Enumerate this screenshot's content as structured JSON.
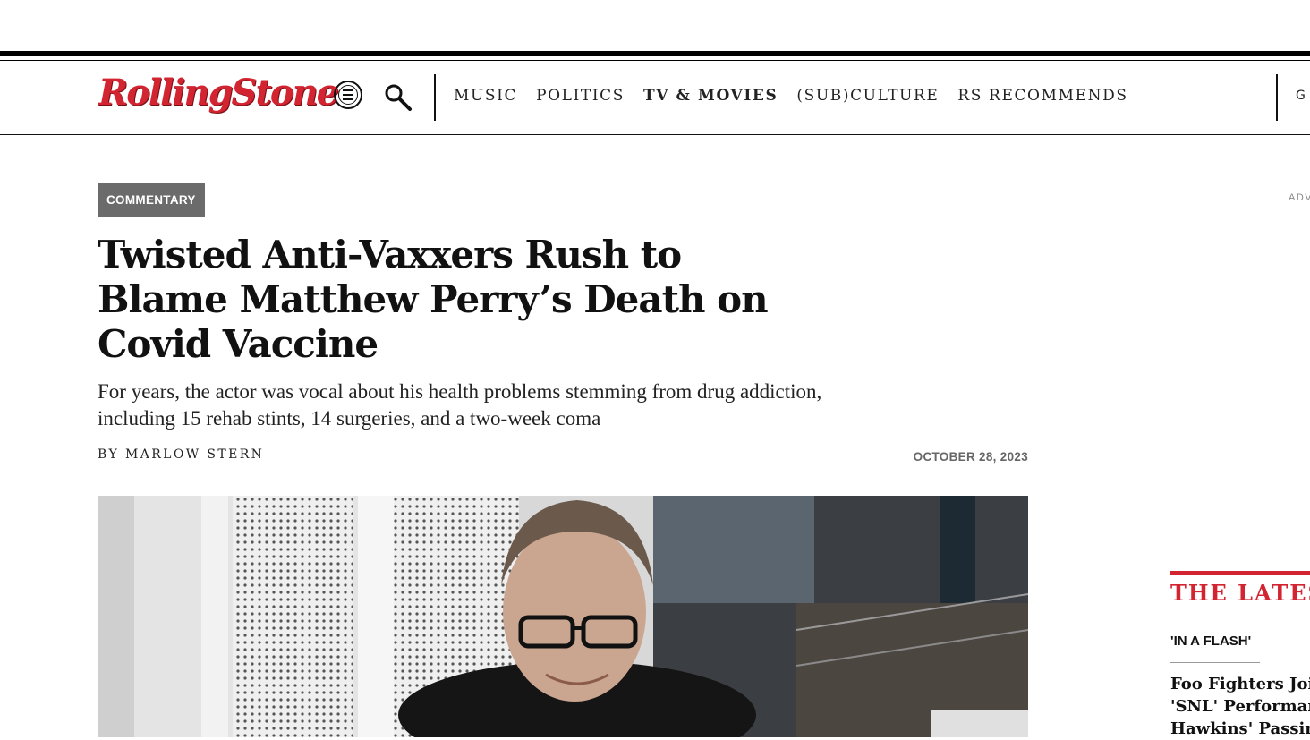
{
  "brand": {
    "logo_text": "RollingStone",
    "accent_color": "#d32531"
  },
  "header": {
    "menu_icon": "hamburger-circle-icon",
    "search_icon": "search-icon",
    "nav": [
      "MUSIC",
      "POLITICS",
      "TV & MOVIES",
      "(SUB)CULTURE",
      "RS RECOMMENDS"
    ],
    "nav_active": "TV & MOVIES",
    "nav_right_partial": "G"
  },
  "article": {
    "category": "COMMENTARY",
    "headline": "Twisted Anti-Vaxxers Rush to Blame Matthew Perry’s Death on Covid Vaccine",
    "dek": "For years, the actor was vocal about his health problems stemming from drug addiction, including 15 rehab stints, 14 surgeries, and a two-week coma",
    "byline_prefix": "BY",
    "author": "MARLOW STERN",
    "date": "OCTOBER 28, 2023"
  },
  "sidebar": {
    "ad_label": "ADV",
    "latest_title": "THE LATEST",
    "latest_kicker": "'IN A FLASH'",
    "latest_story_lines": [
      "Foo Fighters Join",
      "'SNL' Performance",
      "Hawkins' Passing"
    ]
  }
}
